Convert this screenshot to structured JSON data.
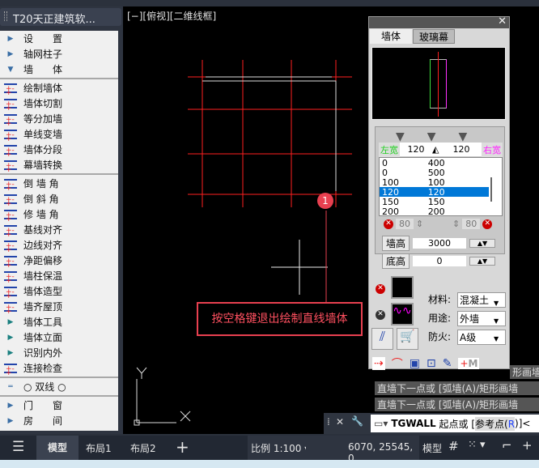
{
  "sidebar": {
    "title": "T20天正建筑软...",
    "items": [
      {
        "label": "设　　置",
        "icon": "triangle-right-icon"
      },
      {
        "label": "轴网柱子",
        "icon": "triangle-right-icon"
      },
      {
        "label": "墙　　体",
        "icon": "triangle-down-icon"
      },
      {
        "label": "绘制墙体",
        "icon": "draw-wall-icon"
      },
      {
        "label": "墙体切割",
        "icon": "wall-cut-icon"
      },
      {
        "label": "等分加墙",
        "icon": "divide-wall-icon"
      },
      {
        "label": "单线变墙",
        "icon": "line-to-wall-icon"
      },
      {
        "label": "墙体分段",
        "icon": "wall-segment-icon"
      },
      {
        "label": "幕墙转换",
        "icon": "curtain-wall-icon"
      },
      {
        "label": "倒 墙 角",
        "icon": "fillet-wall-icon"
      },
      {
        "label": "倒 斜 角",
        "icon": "chamfer-wall-icon"
      },
      {
        "label": "修 墙 角",
        "icon": "fix-corner-icon"
      },
      {
        "label": "基线对齐",
        "icon": "baseline-align-icon"
      },
      {
        "label": "边线对齐",
        "icon": "edge-align-icon"
      },
      {
        "label": "净距偏移",
        "icon": "offset-icon"
      },
      {
        "label": "墙柱保温",
        "icon": "insulation-icon"
      },
      {
        "label": "墙体造型",
        "icon": "wall-shape-icon"
      },
      {
        "label": "墙齐屋顶",
        "icon": "roof-align-icon"
      },
      {
        "label": "墙体工具",
        "icon": "triangle-right-icon"
      },
      {
        "label": "墙体立面",
        "icon": "triangle-right-icon"
      },
      {
        "label": "识别内外",
        "icon": "triangle-right-icon"
      },
      {
        "label": "连接检查",
        "icon": "check-icon"
      },
      {
        "label": "○ 双线 ○",
        "icon": "double-line-icon"
      },
      {
        "label": "门　　窗",
        "icon": "triangle-right-icon"
      },
      {
        "label": "房　　间",
        "icon": "triangle-right-icon"
      }
    ]
  },
  "viewport": {
    "label": "[−][俯视][二维线框]",
    "badge": "1",
    "tooltip": "按空格键退出绘制直线墙体",
    "ucs_x": "X",
    "ucs_y": "Y"
  },
  "panel": {
    "tabs": [
      "墙体",
      "玻璃幕"
    ],
    "left_label": "左宽",
    "right_label": "右宽",
    "left_width": "120",
    "right_width": "120",
    "widths": [
      [
        "0",
        "400"
      ],
      [
        "0",
        "500"
      ],
      [
        "100",
        "100"
      ],
      [
        "120",
        "120"
      ],
      [
        "150",
        "150"
      ],
      [
        "200",
        "200"
      ]
    ],
    "selected_index": 3,
    "left_spin": "80",
    "right_spin": "80",
    "height_label": "墙高",
    "height": "3000",
    "base_label": "底高",
    "base": "0",
    "material_label": "材料:",
    "material": "混凝土",
    "use_label": "用途:",
    "use": "外墙",
    "fire_label": "防火:",
    "fire": "A级",
    "m_label": "M"
  },
  "command": {
    "history": [
      "形画墙",
      "直墙下一点或 [弧墙(A)/矩形画墙",
      "直墙下一点或 [弧墙(A)/矩形画墙"
    ],
    "prompt_cmd": "TGWALL",
    "prompt_text": "起点或 [",
    "prompt_opt": "参考点(",
    "prompt_key": "R",
    "prompt_end": ")]<"
  },
  "statusbar": {
    "tabs": [
      "模型",
      "布局1",
      "布局2"
    ],
    "add": "+",
    "scale": "比例 1:100",
    "coords": "6070, 25545, 0",
    "model": "模型"
  },
  "colors": {
    "grid": "#ff2020",
    "wall": "#ffffff",
    "selected": "#0078d7",
    "badge": "#e84050"
  }
}
